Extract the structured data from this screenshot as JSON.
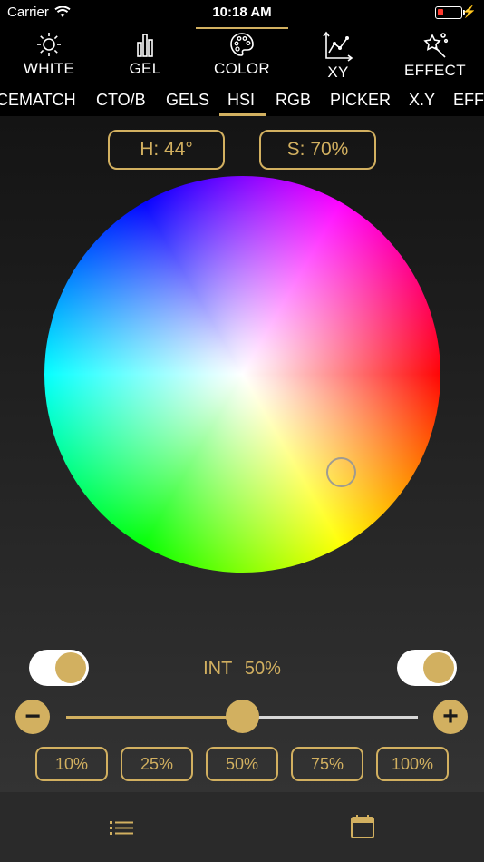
{
  "status_bar": {
    "carrier": "Carrier",
    "time": "10:18 AM"
  },
  "mode_nav": [
    {
      "label": "WHITE",
      "icon": "sun-icon"
    },
    {
      "label": "GEL",
      "icon": "bars-icon"
    },
    {
      "label": "COLOR",
      "icon": "palette-icon",
      "selected": true
    },
    {
      "label": "XY",
      "icon": "xy-chart-icon"
    },
    {
      "label": "EFFECT",
      "icon": "magic-wand-icon"
    }
  ],
  "sub_tabs": [
    {
      "label": "CEMATCH"
    },
    {
      "label": "CTO/B"
    },
    {
      "label": "GELS"
    },
    {
      "label": "HSI",
      "selected": true
    },
    {
      "label": "RGB"
    },
    {
      "label": "PICKER"
    },
    {
      "label": "X.Y"
    },
    {
      "label": "EFF"
    }
  ],
  "hue_label": "H: 44°",
  "saturation_label": "S: 70%",
  "intensity": {
    "label": "INT",
    "value": "50%",
    "level": 0.5
  },
  "toggles": {
    "left_on": true,
    "right_on": true
  },
  "slider": {
    "minus": "−",
    "plus": "+"
  },
  "presets": [
    "10%",
    "25%",
    "50%",
    "75%",
    "100%"
  ],
  "bottom_bar": {
    "left_icon": "list-icon",
    "right_icon": "calendar-icon"
  },
  "colors": {
    "accent": "#d2b060",
    "background": "#000000",
    "bottom_bar": "#2a2a2a"
  }
}
